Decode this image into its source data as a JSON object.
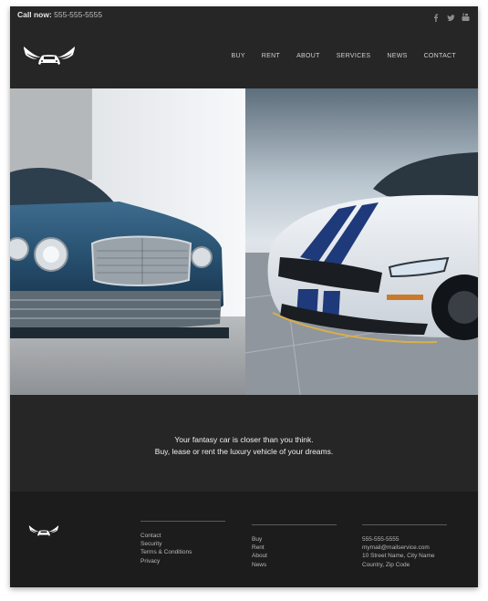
{
  "topbar": {
    "call_label": "Call now:",
    "phone": "555-555-5555",
    "social": [
      "facebook-icon",
      "twitter-icon",
      "youtube-icon"
    ]
  },
  "nav": {
    "items": [
      "BUY",
      "RENT",
      "ABOUT",
      "SERVICES",
      "NEWS",
      "CONTACT"
    ]
  },
  "tagline": {
    "line1": "Your fantasy car is closer than you think.",
    "line2": "Buy, lease or rent the luxury vehicle of your dreams."
  },
  "footer": {
    "col1": [
      "Contact",
      "Security",
      "Terms & Conditions",
      "Privacy"
    ],
    "col2": [
      "Buy",
      "Rent",
      "About",
      "News"
    ],
    "col3": [
      "555-555-5555",
      "mymail@mailservice.com",
      "10 Street Name, City Name",
      "Country, Zip Code"
    ]
  },
  "colors": {
    "header_bg": "#262626",
    "footer_bg": "#1c1c1c",
    "text_light": "#f0f0f0"
  }
}
